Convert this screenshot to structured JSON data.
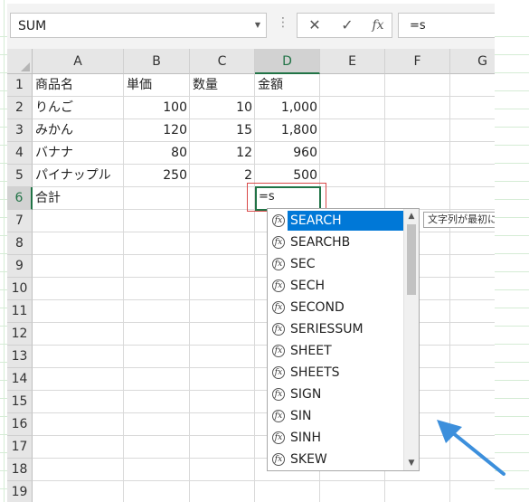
{
  "formula_bar": {
    "name_box": "SUM",
    "separator": "⋮",
    "cancel_icon": "✕",
    "enter_icon": "✓",
    "fx_label": "fx",
    "formula": "=s"
  },
  "columns": [
    "A",
    "B",
    "C",
    "D",
    "E",
    "F",
    "G"
  ],
  "rows": [
    "1",
    "2",
    "3",
    "4",
    "5",
    "6",
    "7",
    "8",
    "9",
    "10",
    "11",
    "12",
    "13",
    "14",
    "15",
    "16",
    "17",
    "18",
    "19"
  ],
  "table": [
    {
      "a": "商品名",
      "b": "単価",
      "c": "数量",
      "d": "金額"
    },
    {
      "a": "りんご",
      "b": "100",
      "c": "10",
      "d": "1,000"
    },
    {
      "a": "みかん",
      "b": "120",
      "c": "15",
      "d": "1,800"
    },
    {
      "a": "バナナ",
      "b": "80",
      "c": "12",
      "d": "960"
    },
    {
      "a": "パイナップル",
      "b": "250",
      "c": "2",
      "d": "500"
    },
    {
      "a": "合計",
      "b": "",
      "c": "",
      "d": ""
    }
  ],
  "active_cell": {
    "address": "D6",
    "value": "=s"
  },
  "autocomplete": {
    "items": [
      "SEARCH",
      "SEARCHB",
      "SEC",
      "SECH",
      "SECOND",
      "SERIESSUM",
      "SHEET",
      "SHEETS",
      "SIGN",
      "SIN",
      "SINH",
      "SKEW"
    ],
    "selected": "SEARCH",
    "fx_icon": "fx",
    "scroll_up": "▲",
    "scroll_down": "▼"
  },
  "tooltip": "文字列が最初に",
  "colors": {
    "accent": "#217346",
    "selection": "#0078d7",
    "highlight_box": "#d94a4a",
    "arrow": "#3c8fdc"
  }
}
